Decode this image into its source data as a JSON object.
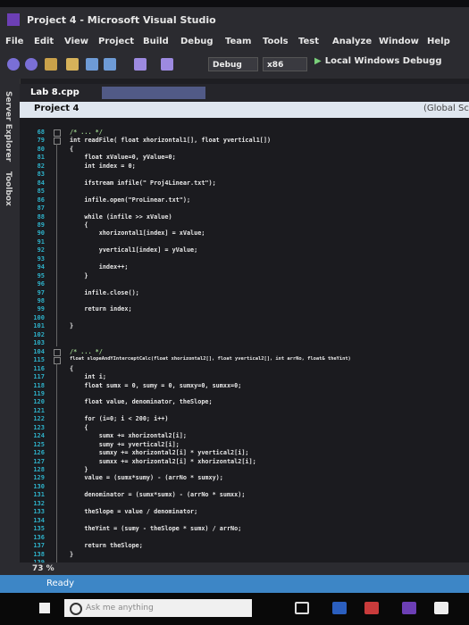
{
  "window": {
    "title": "Project 4 - Microsoft Visual Studio"
  },
  "menu": {
    "items": [
      "File",
      "Edit",
      "View",
      "Project",
      "Build",
      "Debug",
      "Team",
      "Tools",
      "Test",
      "Analyze",
      "Window",
      "Help"
    ]
  },
  "toolbar": {
    "config": "Debug",
    "platform": "x86",
    "run_label": "Local Windows Debugg"
  },
  "sidebar": {
    "tabs": [
      "Server Explorer",
      "Toolbox"
    ]
  },
  "doc_tabs": {
    "active": "Lab 8.cpp"
  },
  "nav": {
    "project": "Project 4",
    "scope": "(Global Sc"
  },
  "editor": {
    "lines": [
      {
        "n": "68",
        "text": "/* ... */"
      },
      {
        "n": "79",
        "text": "int readFile( float xhorizontal1[], float yvertical1[])"
      },
      {
        "n": "80",
        "text": "{"
      },
      {
        "n": "81",
        "text": "    float xValue=0, yValue=0;"
      },
      {
        "n": "82",
        "text": "    int index = 0;"
      },
      {
        "n": "83",
        "text": ""
      },
      {
        "n": "84",
        "text": "    ifstream infile(\" Proj4Linear.txt\");"
      },
      {
        "n": "85",
        "text": ""
      },
      {
        "n": "86",
        "text": "    infile.open(\"ProLinear.txt\");"
      },
      {
        "n": "87",
        "text": ""
      },
      {
        "n": "88",
        "text": "    while (infile >> xValue)"
      },
      {
        "n": "89",
        "text": "    {"
      },
      {
        "n": "90",
        "text": "        xhorizontal1[index] = xValue;"
      },
      {
        "n": "91",
        "text": ""
      },
      {
        "n": "92",
        "text": "        yvertical1[index] = yValue;"
      },
      {
        "n": "93",
        "text": ""
      },
      {
        "n": "94",
        "text": "        index++;"
      },
      {
        "n": "95",
        "text": "    }"
      },
      {
        "n": "96",
        "text": ""
      },
      {
        "n": "97",
        "text": "    infile.close();"
      },
      {
        "n": "98",
        "text": ""
      },
      {
        "n": "99",
        "text": "    return index;"
      },
      {
        "n": "100",
        "text": ""
      },
      {
        "n": "101",
        "text": "}"
      },
      {
        "n": "102",
        "text": ""
      },
      {
        "n": "103",
        "text": ""
      },
      {
        "n": "104",
        "text": "/* ... */"
      },
      {
        "n": "115",
        "text": "float slopeAndYInterceptCalc(float xhorizontal2[], float yvertical2[], int arrNo, float& theYint)"
      },
      {
        "n": "116",
        "text": "{"
      },
      {
        "n": "117",
        "text": "    int i;"
      },
      {
        "n": "118",
        "text": "    float sumx = 0, sumy = 0, sumxy=0, sumxx=0;"
      },
      {
        "n": "119",
        "text": ""
      },
      {
        "n": "120",
        "text": "    float value, denominator, theSlope;"
      },
      {
        "n": "121",
        "text": ""
      },
      {
        "n": "122",
        "text": "    for (i=0; i < 200; i++)"
      },
      {
        "n": "123",
        "text": "    {"
      },
      {
        "n": "124",
        "text": "        sumx += xhorizontal2[i];"
      },
      {
        "n": "125",
        "text": "        sumy += yvertical2[i];"
      },
      {
        "n": "126",
        "text": "        sumxy += xhorizontal2[i] * yvertical2[i];"
      },
      {
        "n": "127",
        "text": "        sumxx += xhorizontal2[i] * xhorizontal2[i];"
      },
      {
        "n": "128",
        "text": "    }"
      },
      {
        "n": "129",
        "text": "    value = (sumx*sumy) - (arrNo * sumxy);"
      },
      {
        "n": "130",
        "text": ""
      },
      {
        "n": "131",
        "text": "    denominator = (sumx*sumx) - (arrNo * sumxx);"
      },
      {
        "n": "132",
        "text": ""
      },
      {
        "n": "133",
        "text": "    theSlope = value / denominator;"
      },
      {
        "n": "134",
        "text": ""
      },
      {
        "n": "135",
        "text": "    theYint = (sumy - theSlope * sumx) / arrNo;"
      },
      {
        "n": "136",
        "text": ""
      },
      {
        "n": "137",
        "text": "    return theSlope;"
      },
      {
        "n": "138",
        "text": "}"
      },
      {
        "n": "139",
        "text": ""
      }
    ]
  },
  "zoom": {
    "level": "73 %"
  },
  "status": {
    "text": "Ready"
  },
  "taskbar": {
    "search_hint": "Ask me anything"
  },
  "colors": {
    "status_blue": "#3d86c6",
    "line_number": "#2eb0c8",
    "editor_bg": "#1b1b1f"
  }
}
